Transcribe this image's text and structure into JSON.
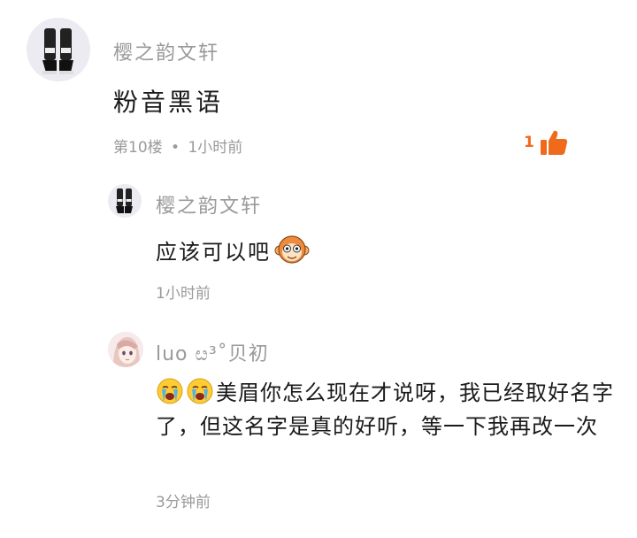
{
  "comment": {
    "username": "樱之韵文轩",
    "content": "粉音黑语",
    "floor": "第10楼",
    "separator": "•",
    "time": "1小时前",
    "like_count": "1",
    "avatar_icon": "boots-avatar",
    "accent_color": "#f06a1c"
  },
  "replies": [
    {
      "username": "樱之韵文轩",
      "content": "应该可以吧",
      "trailing_emoji": "monkey-face-emoji",
      "time": "1小时前",
      "avatar_icon": "boots-avatar"
    },
    {
      "username": "luo ೞ³˚贝初",
      "leading_emoji": [
        "crying-face-emoji",
        "crying-face-emoji"
      ],
      "content": "美眉你怎么现在才说呀，我已经取好名字了，但这名字是真的好听，等一下我再改一次",
      "time": "3分钟前",
      "avatar_icon": "anime-girl-avatar"
    }
  ]
}
